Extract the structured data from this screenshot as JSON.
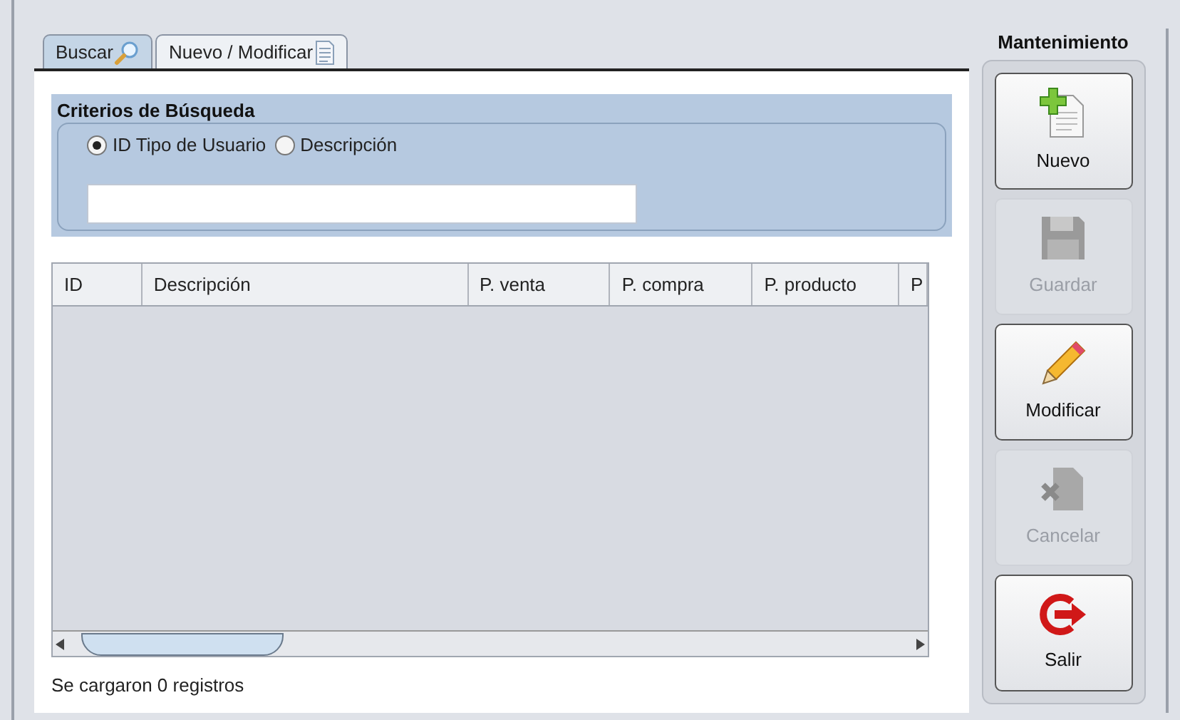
{
  "tabs": [
    {
      "label": "Buscar",
      "kind": "search",
      "selected": true
    },
    {
      "label": "Nuevo / Modificar",
      "kind": "document",
      "selected": false
    }
  ],
  "criteria": {
    "title": "Criterios de Búsqueda",
    "options": [
      {
        "label": "ID Tipo de Usuario",
        "selected": true
      },
      {
        "label": "Descripción",
        "selected": false
      }
    ]
  },
  "table": {
    "columns": [
      "ID",
      "Descripción",
      "P. venta",
      "P. compra",
      "P. producto",
      "P"
    ]
  },
  "status_bar": "Se cargaron 0 registros",
  "sidebar": {
    "title": "Mantenimiento",
    "buttons": [
      {
        "label": "Nuevo",
        "kind": "new",
        "disabled": false
      },
      {
        "label": "Guardar",
        "kind": "save",
        "disabled": true
      },
      {
        "label": "Modificar",
        "kind": "edit",
        "disabled": false
      },
      {
        "label": "Cancelar",
        "kind": "cancel",
        "disabled": true
      },
      {
        "label": "Salir",
        "kind": "exit",
        "disabled": false
      }
    ]
  }
}
